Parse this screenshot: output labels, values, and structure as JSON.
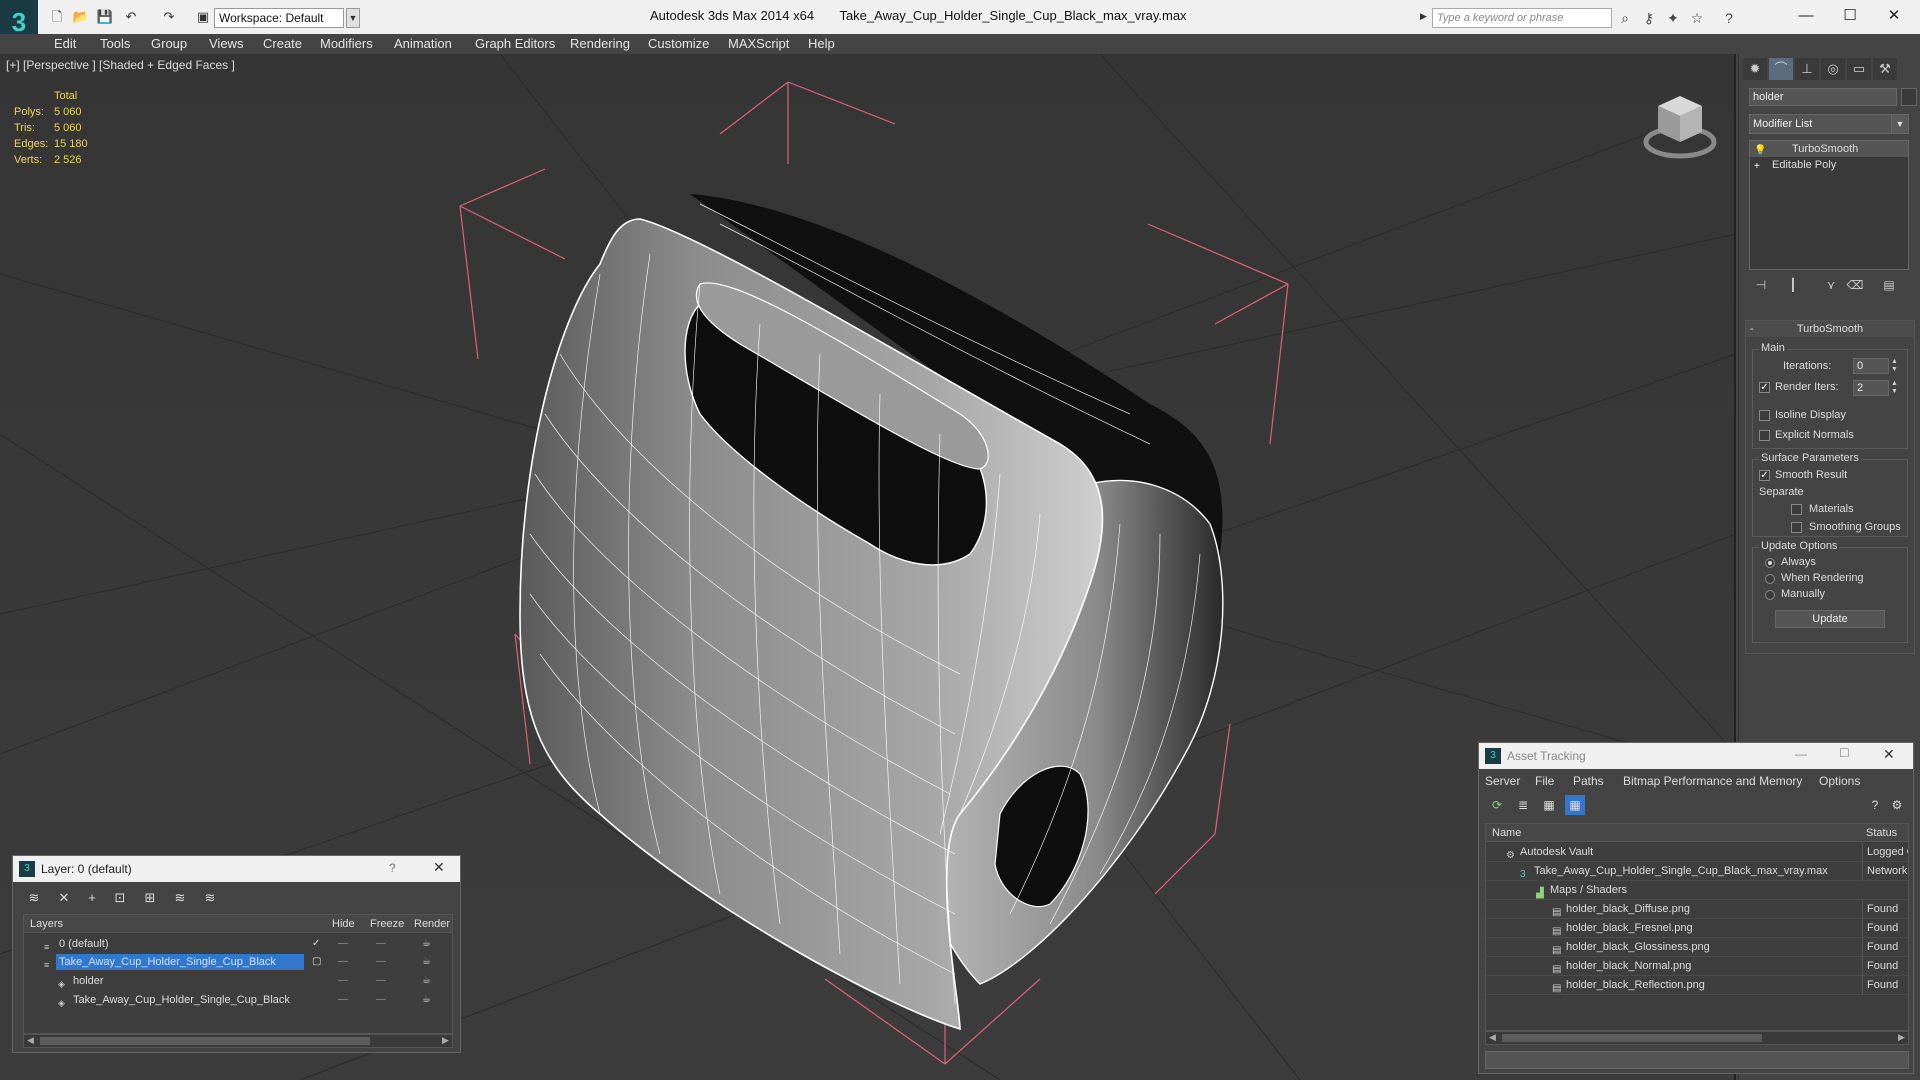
{
  "window": {
    "app_title": "Autodesk 3ds Max  2014 x64",
    "file_title": "Take_Away_Cup_Holder_Single_Cup_Black_max_vray.max",
    "workspace_label": "Workspace: Default",
    "search_placeholder": "Type a keyword or phrase"
  },
  "menu": [
    "Edit",
    "Tools",
    "Group",
    "Views",
    "Create",
    "Modifiers",
    "Animation",
    "Graph Editors",
    "Rendering",
    "Customize",
    "MAXScript",
    "Help"
  ],
  "viewport": {
    "label": "[+] [Perspective ] [Shaded + Edged Faces ]",
    "stats": {
      "header": "Total",
      "rows": [
        {
          "label": "Polys:",
          "value": "5 060"
        },
        {
          "label": "Tris:",
          "value": "5 060"
        },
        {
          "label": "Edges:",
          "value": "15 180"
        },
        {
          "label": "Verts:",
          "value": "2 526"
        }
      ]
    }
  },
  "command_panel": {
    "object_name": "holder",
    "modifier_list_label": "Modifier List",
    "stack": [
      "TurboSmooth",
      "Editable Poly"
    ],
    "rollout_title": "TurboSmooth",
    "main_group": "Main",
    "iterations_label": "Iterations:",
    "iterations_value": "0",
    "render_iters_label": "Render Iters:",
    "render_iters_value": "2",
    "isoline_label": "Isoline Display",
    "explicit_normals_label": "Explicit Normals",
    "surface_group": "Surface Parameters",
    "smooth_result_label": "Smooth Result",
    "separate_label": "Separate",
    "materials_label": "Materials",
    "smoothing_groups_label": "Smoothing Groups",
    "update_group": "Update Options",
    "always_label": "Always",
    "when_rendering_label": "When Rendering",
    "manually_label": "Manually",
    "update_button": "Update"
  },
  "layer_dialog": {
    "title": "Layer: 0 (default)",
    "help": "?",
    "columns": [
      "Layers",
      "Hide",
      "Freeze",
      "Render"
    ],
    "rows": [
      {
        "name": "0 (default)",
        "indent": 0
      },
      {
        "name": "Take_Away_Cup_Holder_Single_Cup_Black",
        "indent": 0,
        "selected": true
      },
      {
        "name": "holder",
        "indent": 1
      },
      {
        "name": "Take_Away_Cup_Holder_Single_Cup_Black",
        "indent": 1
      }
    ]
  },
  "asset_tracking": {
    "title": "Asset Tracking",
    "menu": [
      "Server",
      "File",
      "Paths",
      "Bitmap Performance and Memory",
      "Options"
    ],
    "columns": [
      "Name",
      "Status"
    ],
    "rows": [
      {
        "name": "Autodesk Vault",
        "status": "Logged O",
        "indent": 1
      },
      {
        "name": "Take_Away_Cup_Holder_Single_Cup_Black_max_vray.max",
        "status": "Network I",
        "indent": 2
      },
      {
        "name": "Maps / Shaders",
        "status": "",
        "indent": 3
      },
      {
        "name": "holder_black_Diffuse.png",
        "status": "Found",
        "indent": 4
      },
      {
        "name": "holder_black_Fresnel.png",
        "status": "Found",
        "indent": 4
      },
      {
        "name": "holder_black_Glossiness.png",
        "status": "Found",
        "indent": 4
      },
      {
        "name": "holder_black_Normal.png",
        "status": "Found",
        "indent": 4
      },
      {
        "name": "holder_black_Reflection.png",
        "status": "Found",
        "indent": 4
      }
    ]
  },
  "colors": {
    "selection": "#3377cc",
    "stats_text": "#f0d25a",
    "bbox": "#e0607a"
  }
}
